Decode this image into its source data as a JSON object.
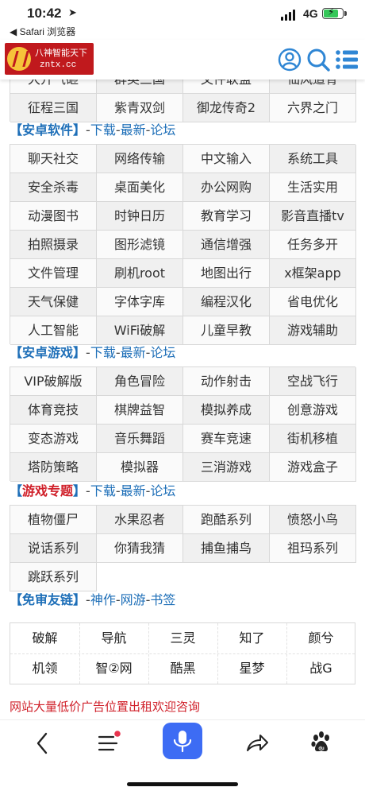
{
  "status_bar": {
    "time": "10:42",
    "back_app": "◀ Safari 浏览器",
    "network": "4G",
    "battery_color": "#35c759"
  },
  "header": {
    "logo_text": "八神智能天下",
    "logo_domain": "zntx.cc",
    "icons": [
      "user-icon",
      "search-icon",
      "menu-icon"
    ],
    "accent_color": "#2f86d4"
  },
  "top_partial_row": [
    "大开气砸",
    "群英三国",
    "文件联盟",
    "仙风道骨"
  ],
  "top_row": [
    "征程三国",
    "紫青双剑",
    "御龙传奇2",
    "六界之门"
  ],
  "sections": {
    "android_software": {
      "title": "安卓软件",
      "links": [
        "下载",
        "最新",
        "论坛"
      ],
      "items": [
        "聊天社交",
        "网络传输",
        "中文输入",
        "系统工具",
        "安全杀毒",
        "桌面美化",
        "办公网购",
        "生活实用",
        "动漫图书",
        "时钟日历",
        "教育学习",
        "影音直播tv",
        "拍照摄录",
        "图形滤镜",
        "通信增强",
        "任务多开",
        "文件管理",
        "刷机root",
        "地图出行",
        "x框架app",
        "天气保健",
        "字体字库",
        "编程汉化",
        "省电优化",
        "人工智能",
        "WiFi破解",
        "儿童早教",
        "游戏辅助"
      ]
    },
    "android_games": {
      "title": "安卓游戏",
      "links": [
        "下载",
        "最新",
        "论坛"
      ],
      "items": [
        "VIP破解版",
        "角色冒险",
        "动作射击",
        "空战飞行",
        "体育竞技",
        "棋牌益智",
        "模拟养成",
        "创意游戏",
        "变态游戏",
        "音乐舞蹈",
        "赛车竞速",
        "街机移植",
        "塔防策略",
        "模拟器",
        "三消游戏",
        "游戏盒子"
      ]
    },
    "game_topics": {
      "title": "游戏专题",
      "links": [
        "下载",
        "最新",
        "论坛"
      ],
      "items": [
        "植物僵尸",
        "水果忍者",
        "跑酷系列",
        "愤怒小鸟",
        "说话系列",
        "你猜我猜",
        "捕鱼捕鸟",
        "祖玛系列",
        "跳跃系列"
      ]
    },
    "friend_links": {
      "title": "免审友链",
      "links": [
        "神作",
        "网游",
        "书签"
      ],
      "items": [
        "破解",
        "导航",
        "三灵",
        "知了",
        "颜兮",
        "机领",
        "智②网",
        "酷黑",
        "星梦",
        "战G"
      ]
    }
  },
  "ad_text": "网站大量低价广告位置出租欢迎咨询",
  "toolbar": {
    "icons": [
      "back-icon",
      "menu-icon",
      "microphone-icon",
      "share-icon",
      "baidu-paw-icon"
    ],
    "mic_color": "#3d6cf4",
    "notify_color": "#e8344e"
  },
  "colors": {
    "link_blue": "#1e6fb8",
    "red": "#d0202a"
  }
}
